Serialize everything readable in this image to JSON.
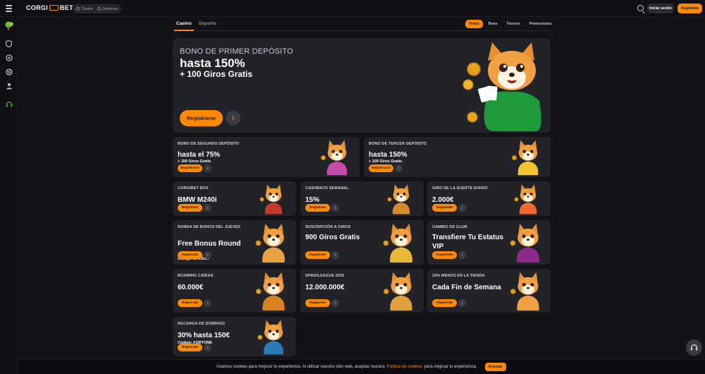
{
  "brand": {
    "left": "CORGI",
    "right": "BET",
    "accent": "#ff8a00"
  },
  "switch": {
    "casino": "Casino",
    "sports": "Deportes"
  },
  "header": {
    "login": "Iniciar sesión",
    "register": "Registrate"
  },
  "tabs": [
    {
      "label": "Casino",
      "active": true
    },
    {
      "label": "Deporte",
      "active": false
    }
  ],
  "filters": [
    {
      "label": "Todos",
      "active": true
    },
    {
      "label": "Bono"
    },
    {
      "label": "Torneos"
    },
    {
      "label": "Promociones"
    }
  ],
  "hero": {
    "eyebrow": "BONO DE PRIMER DEPÓSITO",
    "title": "hasta 150%",
    "subtitle": "+ 100 Giros Gratis",
    "cta": "Registrarse",
    "info": "i"
  },
  "cards": [
    {
      "label": "BONO DE SEGUNDO DEPÓSITO",
      "title": "hasta el 75%",
      "sub": "+ 150 Giros Gratis",
      "cta": "Registrarse",
      "art": "dancing-corgi"
    },
    {
      "label": "BONO DE TERCER DEPÓSITO",
      "title": "hasta 150%",
      "sub": "+ 100 Giros Gratis",
      "cta": "Registrarse",
      "art": "money-corgi"
    },
    {
      "label": "CORGIBET BOX",
      "title": "BMW M240i",
      "sub": "",
      "cta": "Registrate",
      "art": "gift-box"
    },
    {
      "label": "CASHBACK SEMANAL",
      "title": "15%",
      "sub": "",
      "cta": "Registrate",
      "art": "cashback-house"
    },
    {
      "label": "GIRO DE LA SUERTE DIARIO",
      "title": "2.000€",
      "sub": "",
      "cta": "Registrate",
      "art": "sunglasses-corgi"
    },
    {
      "label": "RONDA DE BONOS DEL JUEVES",
      "title": "Free Bonus Round",
      "sub": "Código: SPLASH",
      "cta": "Registrate",
      "art": "coffee-corgi"
    },
    {
      "label": "SUSCRIPCIÓN A GIROS",
      "title": "900 Giros Gratis",
      "sub": "",
      "cta": "Registrate",
      "art": "laurel-corgi"
    },
    {
      "label": "CAMBIO DE CLUB",
      "title": "Transfiere Tu Estatus VIP",
      "sub": "",
      "cta": "Registrate",
      "art": "king-corgi"
    },
    {
      "label": "BOAMING CAÍDAS",
      "title": "60.000€",
      "sub": "",
      "cta": "Registrate",
      "art": "cowboy-corgi"
    },
    {
      "label": "SPINOLEAGUE 2026",
      "title": "12.000.000€",
      "sub": "",
      "cta": "Registrate",
      "art": "zeus-corgi"
    },
    {
      "label": "15% MENOS EN LA TIENDA",
      "title": "Cada Fin de Semana",
      "sub": "",
      "cta": "Registrate",
      "art": "shopping-corgi"
    },
    {
      "label": "RECARGA DE DOMINGO",
      "title": "30% hasta 150€",
      "sub": "Código: FORTUNE",
      "cta": "Registrate",
      "art": "paw-coin"
    }
  ],
  "cookie": {
    "text1": "Usamos cookies para mejorar tu experiencia. Al utilizar nuestro sitio web, aceptas nuestra",
    "link": "Política de cookies",
    "text2": "para mejorar tu experiencia.",
    "accept": "Aceptar"
  }
}
